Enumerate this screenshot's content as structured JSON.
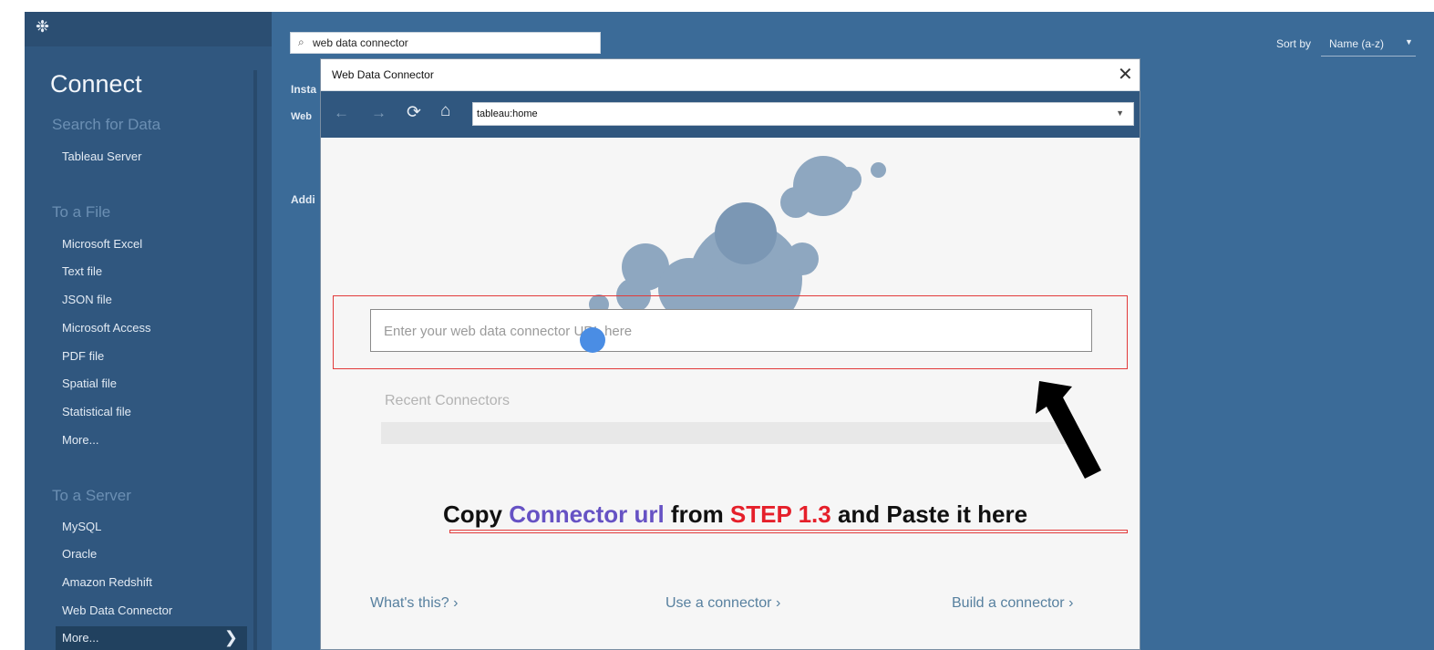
{
  "sidebar": {
    "logo_glyph": "❉",
    "connect_title": "Connect",
    "search_heading": "Search for Data",
    "search_items": [
      "Tableau Server"
    ],
    "file_heading": "To a File",
    "file_items": [
      "Microsoft Excel",
      "Text file",
      "JSON file",
      "Microsoft Access",
      "PDF file",
      "Spatial file",
      "Statistical file",
      "More..."
    ],
    "server_heading": "To a Server",
    "server_items": [
      "MySQL",
      "Oracle",
      "Amazon Redshift",
      "Web Data Connector"
    ],
    "server_more": "More...",
    "more_chevron": "❯"
  },
  "main": {
    "search_value": "web data connector",
    "search_icon": "⌕",
    "sort_label": "Sort by",
    "sort_value": "Name (a-z)",
    "sort_caret": "▼",
    "peek_1": "Insta",
    "peek_2": "Web",
    "peek_3": "Addi"
  },
  "dialog": {
    "title": "Web Data Connector",
    "close_glyph": "✕",
    "nav": {
      "back_glyph": "←",
      "forward_glyph": "→",
      "refresh_glyph": "⟳",
      "home_glyph": "⌂",
      "address": "tableau:home",
      "address_caret": "▼"
    },
    "url_placeholder": "Enter your web data connector URL here",
    "recent_label": "Recent Connectors",
    "links": {
      "whats_this": "What's this? ›",
      "use_connector": "Use a connector ›",
      "build_connector": "Build a connector ›"
    }
  },
  "annotation": {
    "part1": "Copy ",
    "part2": "Connector url",
    "part3": " from ",
    "part4": "STEP 1.3",
    "part5": " and Paste it here"
  },
  "colors": {
    "app_bg": "#3b6b98",
    "sidebar_bg": "#30577f",
    "highlight_red": "#e23a3a",
    "purple": "#6652c4",
    "bubble": "#8ea7c0"
  }
}
